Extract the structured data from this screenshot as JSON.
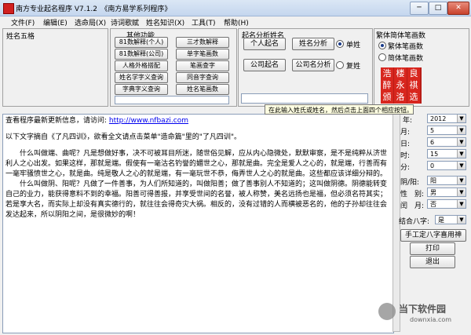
{
  "window": {
    "title": "南方专业起名程序 V7.1.2　《南方易学系列程序》",
    "buttons": {
      "minimize": "─",
      "maximize": "□",
      "close": "✕"
    }
  },
  "menu": [
    "文件(F)",
    "编辑(E)",
    "选命局(X)",
    "诗词歌赋",
    "姓名知识(X)",
    "工具(T)",
    "帮助(H)"
  ],
  "left_panel": {
    "title": "姓名五格"
  },
  "other_funcs": {
    "title": "其他功能",
    "buttons": [
      "81数解释(个人)",
      "三才数解释",
      "81数解释(公司)",
      "单字笔画数",
      "人格外格搭配",
      "笔画查字",
      "姓名学字义查询",
      "同音字查询",
      "字典字义查询",
      "姓名笔画数"
    ]
  },
  "name_analysis": {
    "title": "起名分析姓名",
    "buttons": [
      "个人起名",
      "姓名分析",
      "公司起名",
      "公司名分析"
    ],
    "radio_single": "单姓",
    "radio_compound": "复姓"
  },
  "char_mode": {
    "title": "繁体简体笔画数",
    "radio_trad": "繁体笔画数",
    "radio_simp": "简体笔画数",
    "chars": [
      "浩",
      "楼",
      "良",
      "醉",
      "永",
      "祺",
      "颁",
      "洛",
      "选"
    ]
  },
  "tooltip": "在此输入姓氏或姓名，然后点击上面四个相应按钮。",
  "main_text": {
    "line1_prefix": "查看程序最新更新信息，请访问: ",
    "line1_link": "http://www.nfbazi.com",
    "line2": "以下文字摘自《了凡四训》，欲看全文请点击菜单\"造命篇\"里的\"了凡四训\"。",
    "para1": "　　什么叫做端、曲呢？凡是想做好事，决不可被耳目所迷，随世俗见解，应从内心隐微处，默默审察，是不是纯粹从济世利人之心出发。如果这样，那就是端。假使有一毫沽名钓誉的媚世之心，那就是曲。完全是爱人之心的，就是端，行善而有一毫牢骚愤世之心，就是曲。纯是敬人之心的就是端，有一毫玩世不恭，侮弄世人之心的就是曲。这些都应该详细分辩的。",
    "para2": "　　什么叫做阴、阳呢？凡做了一件善事，为人们所知道的，叫做阳善；做了善事别人不知道的；这叫做阴德。阴德能转变自己的业力，能获得意料不到的幸福。阳善可得善报，并享受世间的名誉，被人称赞，美名远扬也是福，但必须名符其实；若是享大名，而实际上却没有真实德行的，就往往会得奇灾大祸。相反的，没有过错的人而横被恶名的，他的子孙却往往会发达起来，所以阴阳之间，是很微妙的啊！"
  },
  "right_panel": {
    "year_label": "年:",
    "year_value": "2012",
    "month_label": "月:",
    "month_value": "5",
    "day_label": "日:",
    "day_value": "6",
    "hour_label": "时:",
    "hour_value": "15",
    "minute_label": "分:",
    "minute_value": "0",
    "yinyang_label": "阴/阳:",
    "yinyang_value": "阳",
    "gender_label": "性　别:",
    "gender_value": "男",
    "leap_label": "闰　月:",
    "leap_value": "否",
    "bazi_label": "结合八字:",
    "bazi_value": "是",
    "manual_btn": "手工定八字喜用神",
    "print_btn": "打印",
    "exit_btn": "退出"
  },
  "watermark": {
    "text": "当下软件园",
    "sub": "downxia.com"
  }
}
